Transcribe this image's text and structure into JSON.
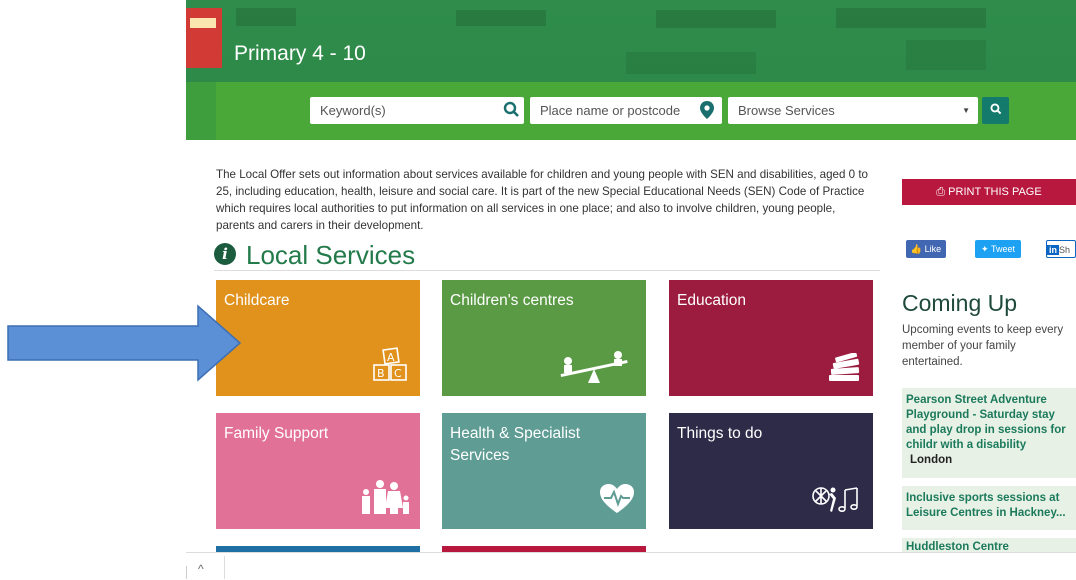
{
  "banner": {
    "title": "Primary 4 - 10"
  },
  "search": {
    "keyword_placeholder": "Keyword(s)",
    "place_placeholder": "Place name or postcode",
    "browse_label": "Browse Services"
  },
  "intro": "The Local Offer sets out information about services available for children and young people with SEN and disabilities, aged 0 to 25, including education, health, leisure and social care. It is part of the new Special Educational Needs (SEN) Code of Practice which requires local authorities to put information on all services in one place; and also to involve children, young people, parents and carers in their development.",
  "section_title": "Local Services",
  "tiles": [
    {
      "label": "Childcare",
      "color": "#e0921c",
      "icon": "abc-blocks-icon"
    },
    {
      "label": "Children's centres",
      "color": "#5a9a45",
      "icon": "seesaw-icon"
    },
    {
      "label": "Education",
      "color": "#9c1c3f",
      "icon": "books-icon"
    },
    {
      "label": "Family Support",
      "color": "#e27197",
      "icon": "family-icon"
    },
    {
      "label": "Health & Specialist Services",
      "color": "#5e9c94",
      "icon": "heart-rate-icon"
    },
    {
      "label": "Things to do",
      "color": "#2e2b48",
      "icon": "ball-music-icon"
    }
  ],
  "sidebar": {
    "print_label": "PRINT THIS PAGE",
    "share": {
      "like": "Like",
      "tweet": "Tweet",
      "linkedin": "Sh"
    },
    "coming_up": "Coming Up",
    "coming_sub": "Upcoming events to keep every member of your family entertained.",
    "events": [
      {
        "title": "Pearson Street Adventure Playground - Saturday stay and play drop in sessions for childr with a disability",
        "location": "London"
      },
      {
        "title": "Inclusive sports sessions at Leisure Centres in Hackney...",
        "location": ""
      },
      {
        "title": "Huddleston Centre",
        "location": ""
      }
    ]
  },
  "colors": {
    "green": "#4aa838",
    "dark_green": "#237a4a",
    "print_red": "#b8173e",
    "arrow_blue": "#5b8fd6"
  }
}
